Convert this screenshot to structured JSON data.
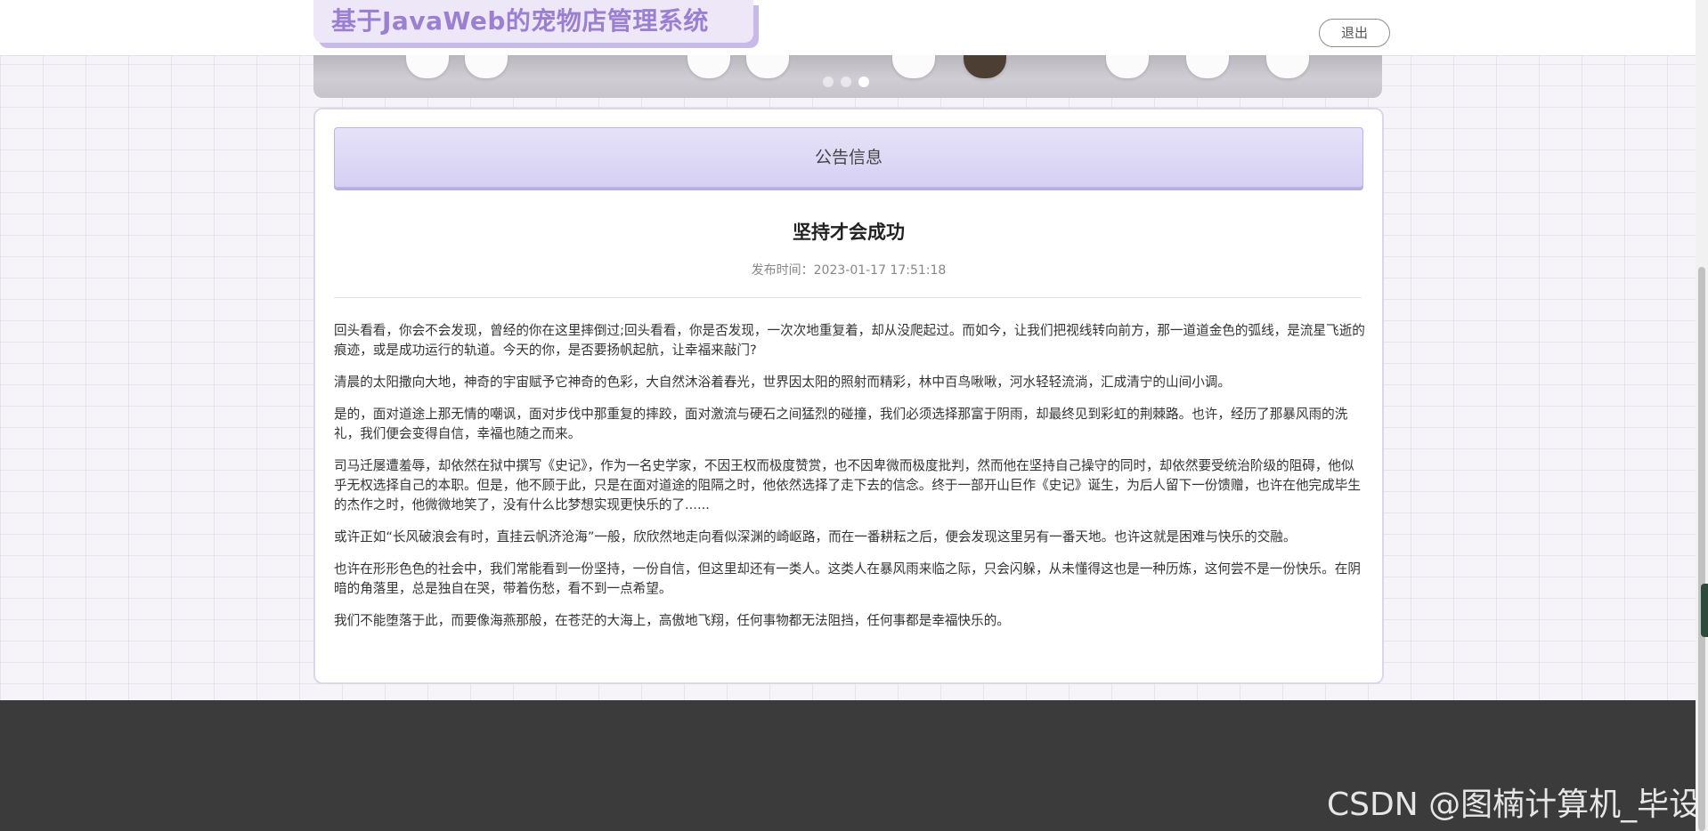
{
  "header": {
    "app_title": "基于JavaWeb的宠物店管理系统",
    "logout_label": "退出"
  },
  "carousel": {
    "slide_count": 3,
    "active_index": 2
  },
  "notice": {
    "section_label": "公告信息",
    "title": "坚持才会成功",
    "meta": "发布时间：2023-01-17 17:51:18",
    "paragraphs": [
      "回头看看，你会不会发现，曾经的你在这里摔倒过;回头看看，你是否发现，一次次地重复着，却从没爬起过。而如今，让我们把视线转向前方，那一道道金色的弧线，是流星飞逝的痕迹，或是成功运行的轨道。今天的你，是否要扬帆起航，让幸福来敲门?",
      "清晨的太阳撒向大地，神奇的宇宙赋予它神奇的色彩，大自然沐浴着春光，世界因太阳的照射而精彩，林中百鸟啾啾，河水轻轻流淌，汇成清宁的山间小调。",
      "是的，面对道途上那无情的嘲讽，面对步伐中那重复的摔跤，面对激流与硬石之间猛烈的碰撞，我们必须选择那富于阴雨，却最终见到彩虹的荆棘路。也许，经历了那暴风雨的洗礼，我们便会变得自信，幸福也随之而来。",
      "司马迁屡遭羞辱，却依然在狱中撰写《史记》，作为一名史学家，不因王权而极度赞赏，也不因卑微而极度批判，然而他在坚持自己操守的同时，却依然要受统治阶级的阻碍，他似乎无权选择自己的本职。但是，他不顾于此，只是在面对道途的阻隔之时，他依然选择了走下去的信念。终于一部开山巨作《史记》诞生，为后人留下一份馈赠，也许在他完成毕生的杰作之时，他微微地笑了，没有什么比梦想实现更快乐的了......",
      "或许正如“长风破浪会有时，直挂云帆济沧海”一般，欣欣然地走向看似深渊的崎岖路，而在一番耕耘之后，便会发现这里另有一番天地。也许这就是困难与快乐的交融。",
      "也许在形形色色的社会中，我们常能看到一份坚持，一份自信，但这里却还有一类人。这类人在暴风雨来临之际，只会闪躲，从未懂得这也是一种历炼，这何尝不是一份快乐。在阴暗的角落里，总是独自在哭，带着伤愁，看不到一点希望。",
      "我们不能堕落于此，而要像海燕那般，在苍茫的大海上，高傲地飞翔，任何事物都无法阻挡，任何事都是幸福快乐的。"
    ]
  },
  "footer": {
    "watermark": "CSDN @图楠计算机_毕设"
  },
  "colors": {
    "brand_text": "#9b7fd1",
    "brand_bg": "#ede7f7",
    "notice_header_bg": "#d6d0f3",
    "footer_bg": "#3b3b3b"
  }
}
